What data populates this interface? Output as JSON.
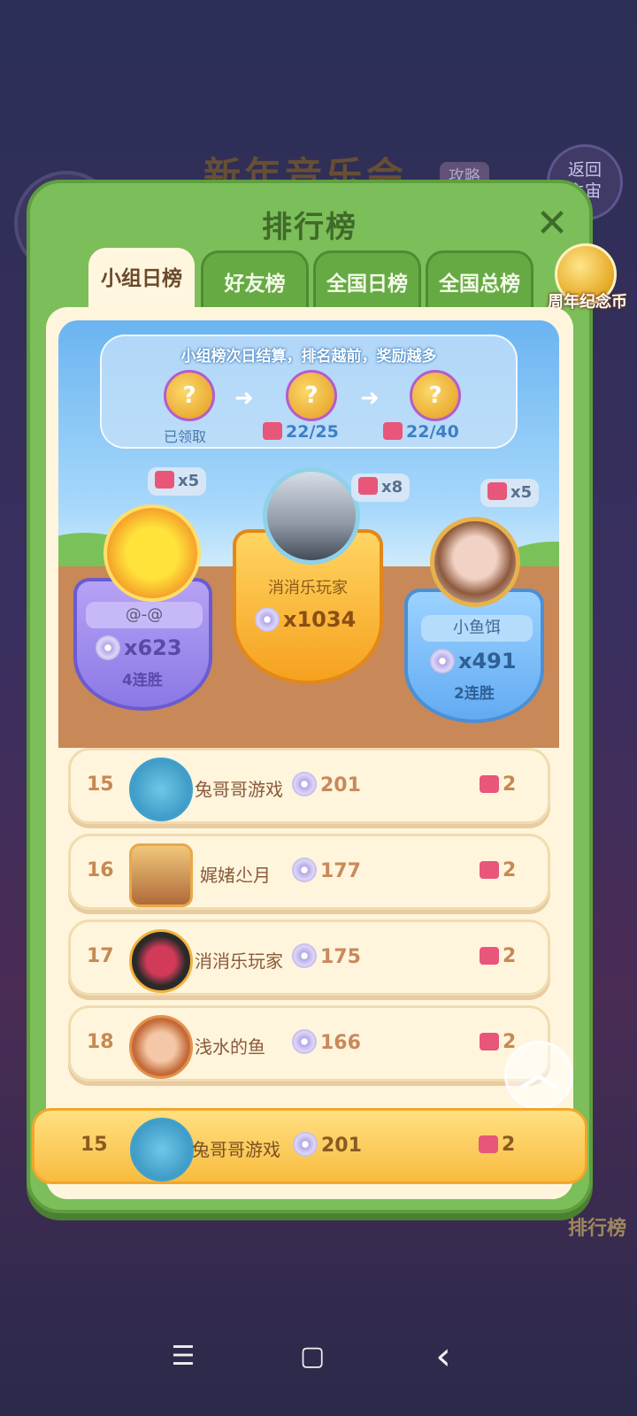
{
  "background": {
    "event_title": "新年音乐会",
    "guide_label": "攻略",
    "back_label_line1": "返回",
    "back_label_line2": "主宙",
    "rank_label": "排行榜"
  },
  "panel": {
    "title": "排行榜",
    "close_icon": "close-icon"
  },
  "tabs": [
    {
      "label": "小组日榜",
      "active": true
    },
    {
      "label": "好友榜",
      "active": false
    },
    {
      "label": "全国日榜",
      "active": false
    },
    {
      "label": "全国总榜",
      "active": false
    }
  ],
  "coin_badge": {
    "label": "周年纪念币",
    "icon": "anniversary-coin-icon"
  },
  "reward": {
    "headline": "小组榜次日结算，排名越前，奖励越多",
    "claimed_label": "已领取",
    "progress1": "22/25",
    "progress2": "22/40",
    "chest_symbol": "?"
  },
  "podium": {
    "second": {
      "name": "@-@",
      "score": "x623",
      "streak": "4连胜",
      "bubble": "x5"
    },
    "first": {
      "name": "消消乐玩家",
      "score": "x1034",
      "bubble": "x8"
    },
    "third": {
      "name": "小鱼饵",
      "score": "x491",
      "streak": "2连胜",
      "bubble": "x5"
    }
  },
  "rows": [
    {
      "rank": "15",
      "name": "兔哥哥游戏",
      "score": "201",
      "pieces": "2"
    },
    {
      "rank": "16",
      "name": "娓媎尐月",
      "score": "177",
      "pieces": "2"
    },
    {
      "rank": "17",
      "name": "消消乐玩家",
      "score": "175",
      "pieces": "2"
    },
    {
      "rank": "18",
      "name": "浅水的鱼",
      "score": "166",
      "pieces": "2"
    }
  ],
  "me": {
    "rank": "15",
    "name": "兔哥哥游戏",
    "score": "201",
    "pieces": "2"
  },
  "scroll_up": "︿",
  "nav": {
    "menu": "☰",
    "home": "▢",
    "back": "‹"
  }
}
